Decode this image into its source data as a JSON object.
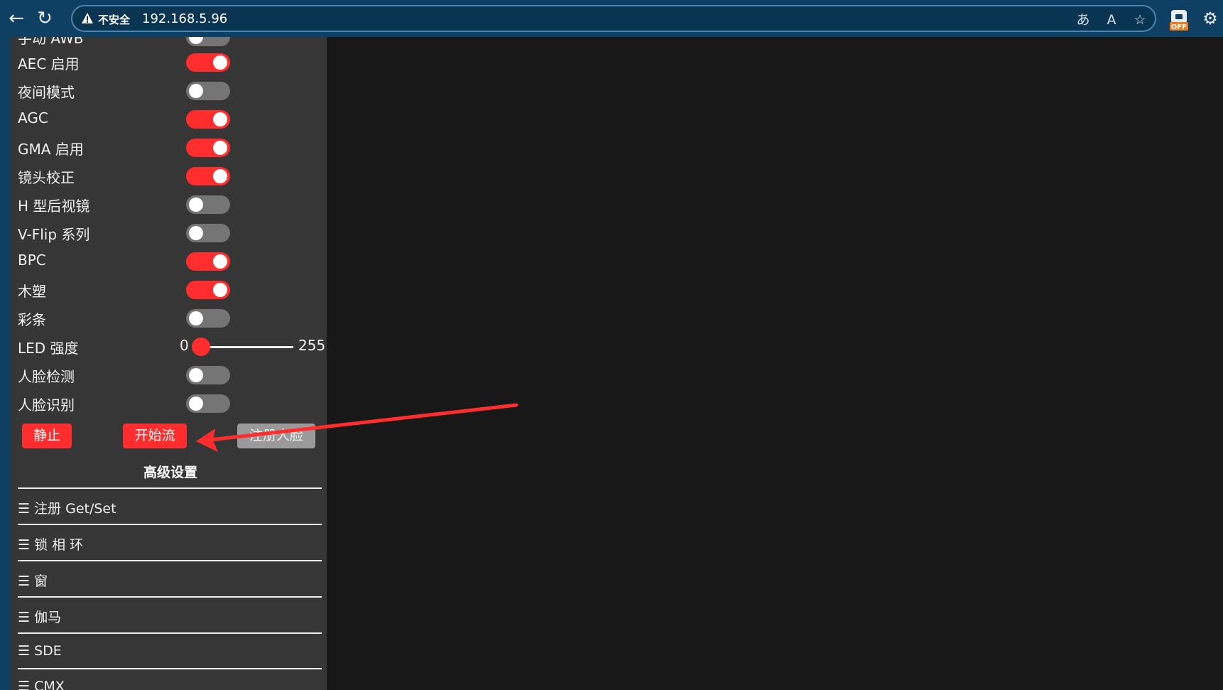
{
  "browser": {
    "security_label": "不安全",
    "url": "192.168.5.96",
    "extension_badge": "OFF",
    "colors": {
      "chrome": "#0f3f62",
      "omnibox": "#0a3552"
    }
  },
  "panel": {
    "partial_top_label": "手动 AWB",
    "toggles": [
      {
        "label": "AEC 启用",
        "on": true
      },
      {
        "label": "夜间模式",
        "on": false
      },
      {
        "label": "AGC",
        "on": true
      },
      {
        "label": "GMA 启用",
        "on": true
      },
      {
        "label": "镜头校正",
        "on": true
      },
      {
        "label": "H 型后视镜",
        "on": false
      },
      {
        "label": "V-Flip 系列",
        "on": false
      },
      {
        "label": "BPC",
        "on": true
      },
      {
        "label": "木塑",
        "on": true
      },
      {
        "label": "彩条",
        "on": false
      }
    ],
    "led": {
      "label": "LED 强度",
      "min": "0",
      "max": "255",
      "value": 0
    },
    "face_toggles": [
      {
        "label": "人脸检测",
        "on": false
      },
      {
        "label": "人脸识别",
        "on": false
      }
    ],
    "buttons": {
      "stop": "静止",
      "start_stream": "开始流",
      "enroll_face": "注册人脸"
    },
    "advanced_title": "高级设置",
    "sections": [
      "☰ 注册 Get/Set",
      "☰ 锁 相 环",
      "☰ 窗",
      "☰ 伽马",
      "☰  SDE",
      "☰  CMX"
    ],
    "accent_color": "#ff2d2d"
  }
}
